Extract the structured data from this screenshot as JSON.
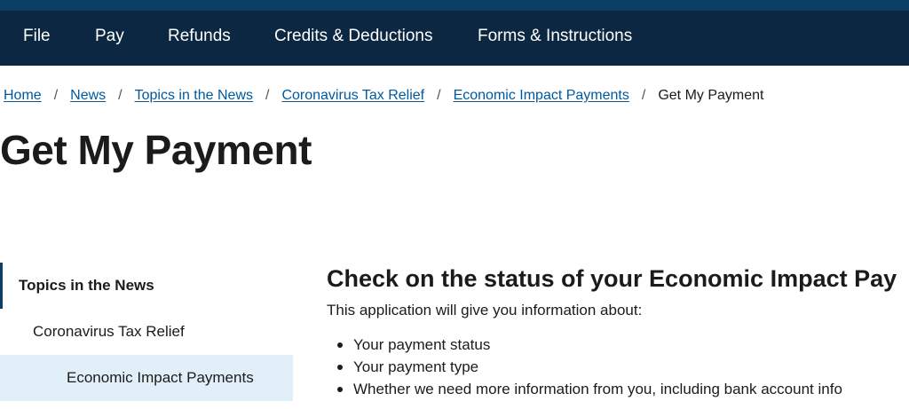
{
  "nav": {
    "items": [
      "File",
      "Pay",
      "Refunds",
      "Credits & Deductions",
      "Forms & Instructions"
    ]
  },
  "breadcrumb": {
    "links": [
      "Home",
      "News",
      "Topics in the News",
      "Coronavirus Tax Relief",
      "Economic Impact Payments"
    ],
    "separator": "/",
    "current": "Get My Payment"
  },
  "page": {
    "title": "Get My Payment"
  },
  "sidebar": {
    "heading": "Topics in the News",
    "items": [
      {
        "label": "Coronavirus Tax Relief",
        "active": false
      },
      {
        "label": "Economic Impact Payments",
        "active": true
      }
    ]
  },
  "content": {
    "heading": "Check on the status of your Economic Impact Pay",
    "intro": "This application will give you information about:",
    "bullets": [
      "Your payment status",
      "Your payment type",
      "Whether we need more information from you, including bank account info"
    ]
  },
  "colors": {
    "nav_background": "#0b2742",
    "top_strip": "#0b3f68",
    "link": "#00599c",
    "active_sidebar_background": "#e1f0f8"
  }
}
